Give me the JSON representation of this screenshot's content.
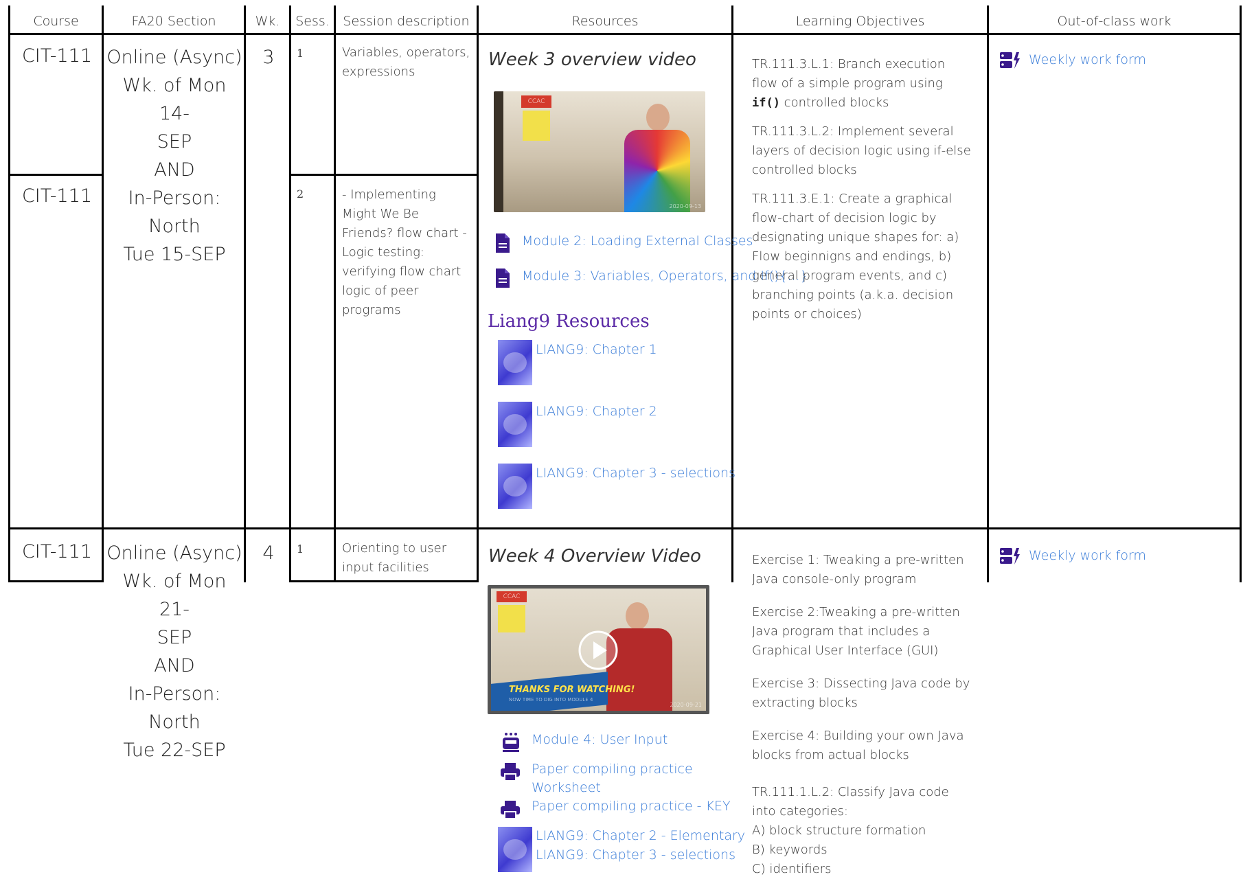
{
  "headers": {
    "course": "Course",
    "section": "FA20 Section",
    "wk": "Wk.",
    "sess": "Sess.",
    "desc": "Session description",
    "resources": "Resources",
    "objectives": "Learning Objectives",
    "out_of_class": "Out-of-class work"
  },
  "week3": {
    "course_a": "CIT-111",
    "course_b": "CIT-111",
    "section_lines": [
      "Online (Async)",
      "Wk. of Mon 14-",
      "SEP",
      "AND",
      "In-Person:",
      "North",
      "Tue 15-SEP"
    ],
    "wk": "3",
    "sess_1": "1",
    "desc_1": "Variables, operators, expressions",
    "sess_2": "2",
    "desc_2": "- Implementing Might We Be Friends? flow chart - Logic testing: verifying flow chart logic of peer programs",
    "video_title": "Week 3 overview video",
    "video_date": "2020-09-13",
    "module_links": [
      "Module 2: Loading External Classes",
      "Module 3: Variables, Operators, and If(){...}"
    ],
    "resources_heading": "Liang9 Resources",
    "liang_links": [
      "LIANG9: Chapter 1",
      "LIANG9: Chapter 2",
      "LIANG9: Chapter 3 - selections"
    ],
    "objectives": [
      {
        "pre": "TR.111.3.L.1: Branch execution flow of a simple program using ",
        "code": "if()",
        "post": " controlled blocks"
      },
      {
        "pre": "TR.111.3.L.2: Implement several layers of decision logic using if-else controlled blocks",
        "code": "",
        "post": ""
      },
      {
        "pre": "TR.111.3.E.1: Create a graphical flow-chart of decision logic by designating unique shapes for: a) Flow beginnigns and endings, b) general program events, and c) branching points (a.k.a. decision points or choices)",
        "code": "",
        "post": ""
      }
    ],
    "out_link": "Weekly work form"
  },
  "week4": {
    "course": "CIT-111",
    "section_lines": [
      "Online (Async)",
      "Wk. of Mon 21-",
      "SEP",
      "AND",
      "In-Person:",
      "North",
      "Tue 22-SEP"
    ],
    "wk": "4",
    "sess_1": "1",
    "desc_1": "Orienting to user input facilities",
    "video_title": "Week 4 Overview Video",
    "video_banner_1": "THANKS FOR WATCHING!",
    "video_banner_2": "NOW TIME TO DIG INTO MODULE 4",
    "video_date": "2020-09-21",
    "links": {
      "module4": "Module 4: User Input",
      "paper": "Paper compiling practice Worksheet",
      "paper_key": "Paper compiling practice - KEY",
      "ch2": "LIANG9: Chapter 2 - Elementary",
      "ch3": "LIANG9: Chapter 3 - selections"
    },
    "objectives": [
      "Exercise 1: Tweaking a pre-written Java console-only program",
      "Exercise 2:Tweaking a pre-written Java program that includes a Graphical User Interface (GUI)",
      "Exercise 3: Dissecting Java code by extracting blocks",
      "Exercise 4: Building your own Java blocks from actual blocks"
    ],
    "classify": {
      "intro": "TR.111.1.L.2: Classify Java code into categories:",
      "a": "A) block structure formation",
      "b": "B) keywords",
      "c": "C) identifiers"
    },
    "out_link": "Weekly work form"
  },
  "colors": {
    "link": "#3b7dd8",
    "heading_purple": "#5b2aa6",
    "icon_purple": "#3a1a8c",
    "grid": "#000000"
  },
  "icons": [
    "document-icon",
    "tasks-icon",
    "train-icon",
    "print-icon",
    "play-icon"
  ]
}
